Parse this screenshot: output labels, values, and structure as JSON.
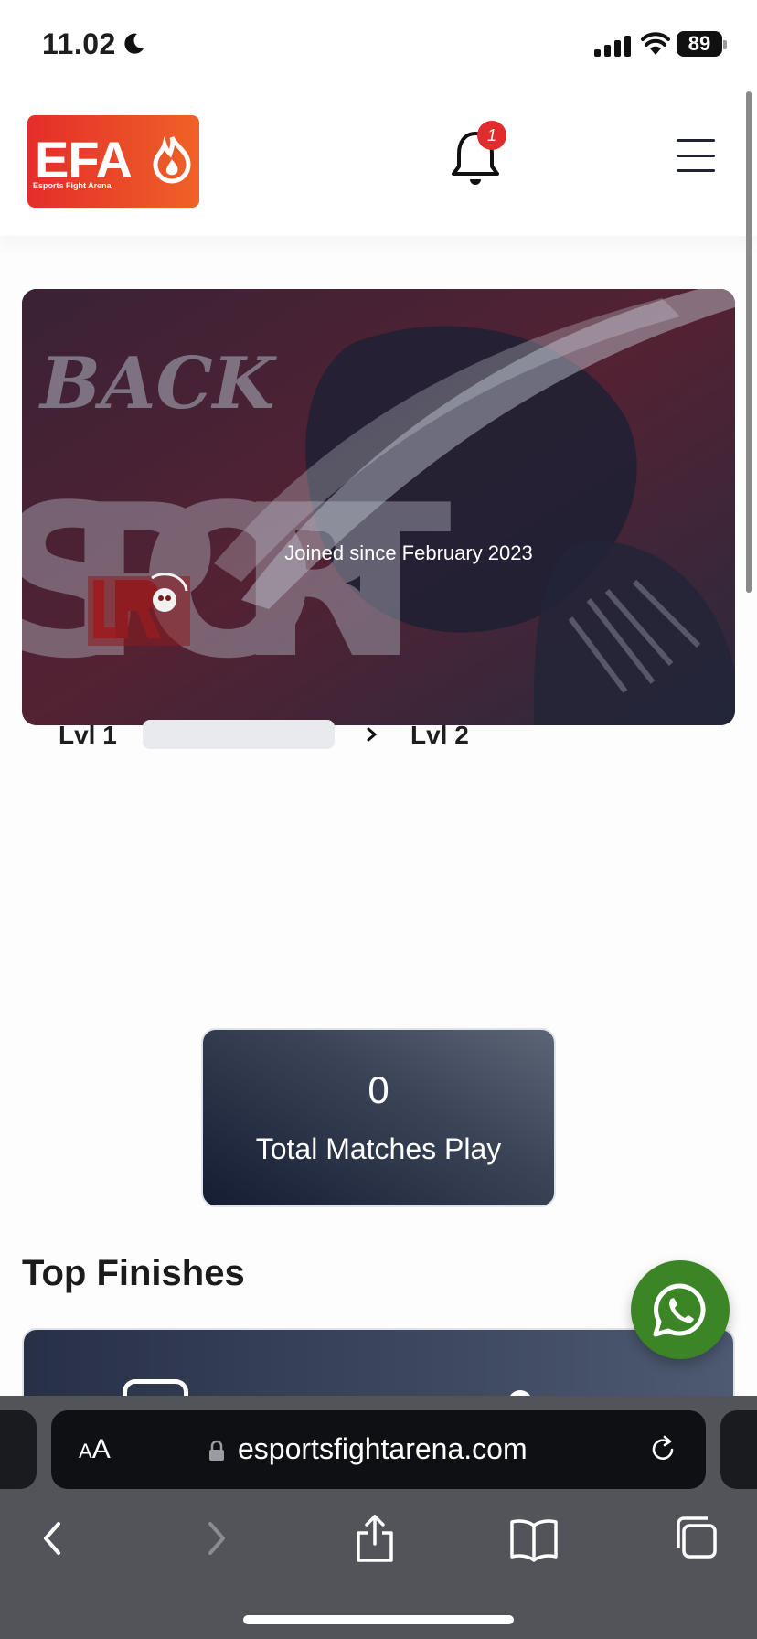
{
  "status_bar": {
    "time": "11.02",
    "battery": "89"
  },
  "header": {
    "logo_text": "EFA",
    "logo_subtitle": "Esports  Fight  Arena",
    "notification_count": "1"
  },
  "profile": {
    "joined_text": "Joined since February 2023",
    "level_current": "Lvl 1",
    "level_next": "Lvl 2",
    "level_progress": 0
  },
  "stats": {
    "total_matches_value": "0",
    "total_matches_label": "Total Matches Play"
  },
  "sections": {
    "top_finishes_title": "Top Finishes"
  },
  "browser": {
    "text_size_label": "AA",
    "url": "esportsfightarena.com"
  },
  "colors": {
    "brand_gradient_start": "#e42d2a",
    "brand_gradient_end": "#ef6227",
    "whatsapp_green": "#3c8527",
    "card_dark": "#151c33"
  }
}
